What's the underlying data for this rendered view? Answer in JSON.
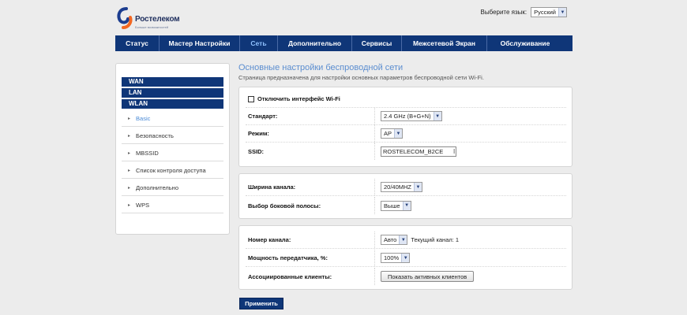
{
  "brand": {
    "name": "Ростелеком",
    "tagline": "Больше возможностей"
  },
  "language": {
    "label": "Выберите язык:",
    "selected": "Русский"
  },
  "nav": [
    {
      "label": "Статус",
      "active": false
    },
    {
      "label": "Мастер Настройки",
      "active": false
    },
    {
      "label": "Сеть",
      "active": true
    },
    {
      "label": "Дополнительно",
      "active": false
    },
    {
      "label": "Сервисы",
      "active": false
    },
    {
      "label": "Межсетевой Экран",
      "active": false
    },
    {
      "label": "Обслуживание",
      "active": false
    }
  ],
  "sidebar": {
    "sections": [
      "WAN",
      "LAN",
      "WLAN"
    ],
    "items": [
      {
        "label": "Basic",
        "active": true
      },
      {
        "label": "Безопасность",
        "active": false
      },
      {
        "label": "MBSSID",
        "active": false
      },
      {
        "label": "Список контроля доступа",
        "active": false
      },
      {
        "label": "Дополнительно",
        "active": false
      },
      {
        "label": "WPS",
        "active": false
      }
    ]
  },
  "page": {
    "title": "Основные настройки беспроводной сети",
    "description": "Страница предназначена для настройки основных параметров беспроводной сети Wi-Fi."
  },
  "panel1": {
    "disable_wifi_label": "Отключить интерфейс Wi-Fi",
    "disable_wifi_checked": false,
    "standard_label": "Стандарт:",
    "standard_value": "2.4 GHz (B+G+N)",
    "mode_label": "Режим:",
    "mode_value": "AP",
    "ssid_label": "SSID:",
    "ssid_value": "ROSTELECOM_B2CE"
  },
  "panel2": {
    "width_label": "Ширина канала:",
    "width_value": "20/40MHZ",
    "sideband_label": "Выбор боковой полосы:",
    "sideband_value": "Выше"
  },
  "panel3": {
    "channel_label": "Номер канала:",
    "channel_value": "Авто",
    "current_channel_text": "Текущий канал: 1",
    "power_label": "Мощность передатчика, %:",
    "power_value": "100%",
    "clients_label": "Ассоциированные клиенты:",
    "clients_button": "Показать активных клиентов"
  },
  "apply_label": "Применить",
  "colors": {
    "nav_bg": "#0f3678",
    "title": "#5c8ed0",
    "active_link": "#4a8ad6",
    "page_bg": "#ececec"
  }
}
